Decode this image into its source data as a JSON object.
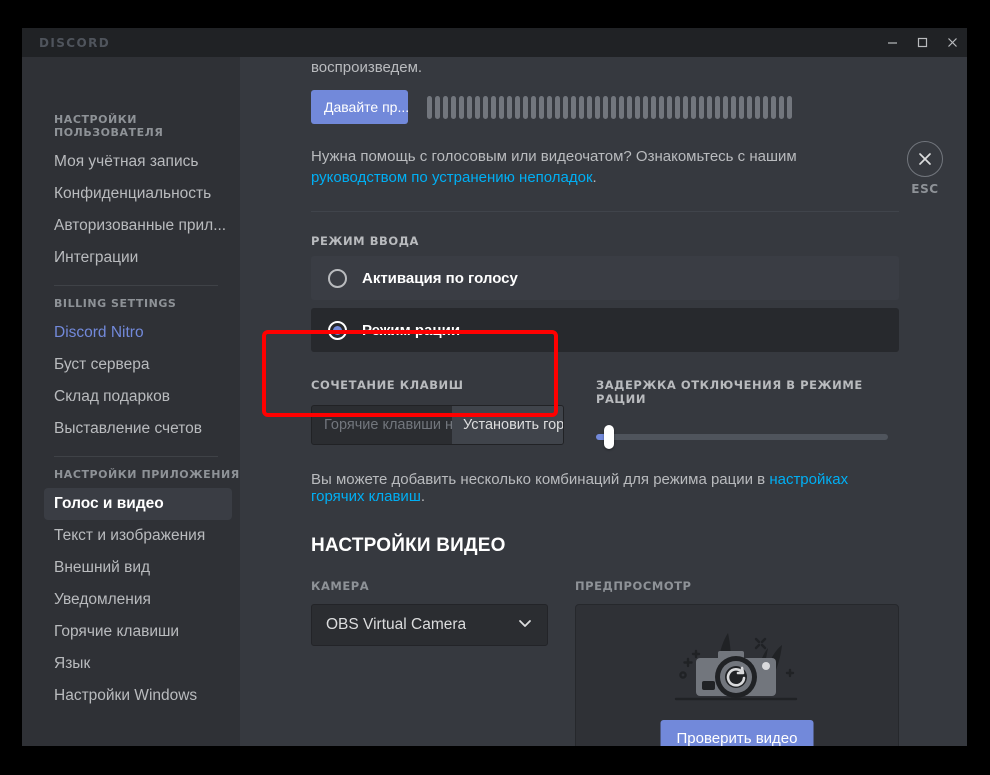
{
  "window": {
    "brand": "DISCORD",
    "controls": {
      "minimize": "minimize-icon",
      "maximize": "maximize-icon",
      "close": "close-icon"
    }
  },
  "esc": {
    "label": "ESC",
    "icon": "close-icon"
  },
  "sidebar": {
    "groups": [
      {
        "title": "НАСТРОЙКИ ПОЛЬЗОВАТЕЛЯ",
        "items": [
          {
            "label": "Моя учётная запись",
            "state": "normal"
          },
          {
            "label": "Конфиденциальность",
            "state": "normal"
          },
          {
            "label": "Авторизованные прил...",
            "state": "normal"
          },
          {
            "label": "Интеграции",
            "state": "normal"
          }
        ]
      },
      {
        "title": "BILLING SETTINGS",
        "items": [
          {
            "label": "Discord Nitro",
            "state": "accent"
          },
          {
            "label": "Буст сервера",
            "state": "normal"
          },
          {
            "label": "Склад подарков",
            "state": "normal"
          },
          {
            "label": "Выставление счетов",
            "state": "normal"
          }
        ]
      },
      {
        "title": "НАСТРОЙКИ ПРИЛОЖЕНИЯ",
        "items": [
          {
            "label": "Голос и видео",
            "state": "active"
          },
          {
            "label": "Текст и изображения",
            "state": "normal"
          },
          {
            "label": "Внешний вид",
            "state": "normal"
          },
          {
            "label": "Уведомления",
            "state": "normal"
          },
          {
            "label": "Горячие клавиши",
            "state": "normal"
          },
          {
            "label": "Язык",
            "state": "normal"
          },
          {
            "label": "Настройки Windows",
            "state": "normal"
          }
        ]
      }
    ]
  },
  "main": {
    "mic_test_tail": "воспроизведем.",
    "mic_test_button": "Давайте пр...",
    "level_bar_count": 46,
    "help_text_1": "Нужна помощь с голосовым или видеочатом? Ознакомьтесь с нашим ",
    "help_link": "руководством по устранению неполадок",
    "help_text_2": ".",
    "input_mode": {
      "label": "РЕЖИМ ВВОДА",
      "options": [
        {
          "label": "Активация по голосу",
          "selected": false
        },
        {
          "label": "Режим рации",
          "selected": true
        }
      ]
    },
    "keybind": {
      "label": "СОЧЕТАНИЕ КЛАВИШ",
      "placeholder": "Горячие клавиши не ...",
      "button": "Установить горяч"
    },
    "release_delay": {
      "label": "ЗАДЕРЖКА ОТКЛЮЧЕНИЯ В РЕЖИМЕ РАЦИИ",
      "value": 0,
      "min": 0,
      "max": 100
    },
    "hint_text_1": "Вы можете добавить несколько комбинаций для режима рации в ",
    "hint_link": "настройках горячих клавиш",
    "hint_text_2": ".",
    "video": {
      "title": "НАСТРОЙКИ ВИДЕО",
      "camera_label": "КАМЕРА",
      "camera_value": "OBS Virtual Camera",
      "camera_chevron": "chevron-down-icon",
      "preview_label": "ПРЕДПРОСМОТР",
      "preview_art": "camera-illustration",
      "test_button": "Проверить видео"
    }
  },
  "annotation": {
    "highlight_color": "#ff0000"
  },
  "colors": {
    "accent": "#7289da",
    "link": "#00aff4",
    "sidebar_bg": "#2f3136",
    "main_bg": "#36393f",
    "titlebar_bg": "#202225"
  }
}
